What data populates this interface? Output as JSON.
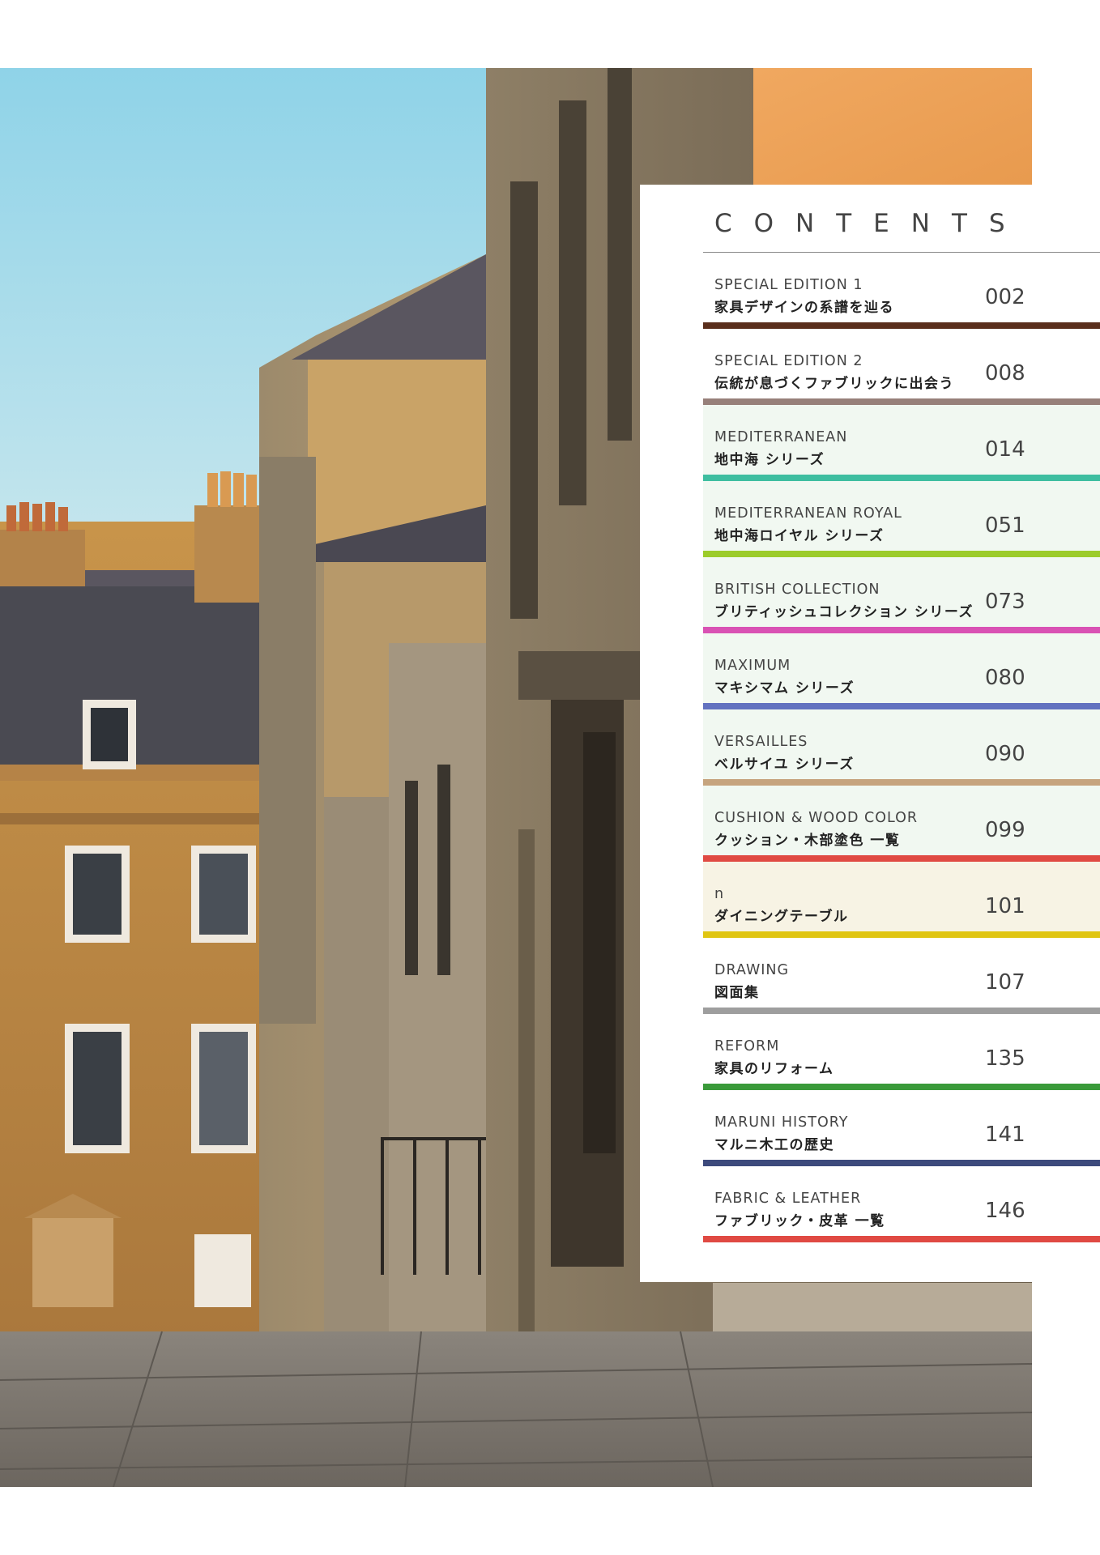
{
  "contents": {
    "title": "CONTENTS",
    "entries": [
      {
        "en": "SPECIAL EDITION 1",
        "jp": "家具デザインの系譜を辿る",
        "page": "002",
        "bar": "#5a2e1c",
        "bg": "#ffffff"
      },
      {
        "en": "SPECIAL EDITION 2",
        "jp": "伝統が息づくファブリックに出会う",
        "page": "008",
        "bar": "#97807a",
        "bg": "#ffffff"
      },
      {
        "en": "MEDITERRANEAN",
        "jp": "地中海 シリーズ",
        "page": "014",
        "bar": "#3ebea0",
        "bg": "#f1f8f1"
      },
      {
        "en": "MEDITERRANEAN ROYAL",
        "jp": "地中海ロイヤル シリーズ",
        "page": "051",
        "bar": "#9ccc2a",
        "bg": "#f1f8f1"
      },
      {
        "en": "BRITISH COLLECTION",
        "jp": "ブリティッシュコレクション シリーズ",
        "page": "073",
        "bar": "#d952b4",
        "bg": "#f1f8f1"
      },
      {
        "en": "MAXIMUM",
        "jp": "マキシマム シリーズ",
        "page": "080",
        "bar": "#6272c0",
        "bg": "#f1f8f1"
      },
      {
        "en": "VERSAILLES",
        "jp": "ベルサイユ シリーズ",
        "page": "090",
        "bar": "#c6a47e",
        "bg": "#f1f8f1"
      },
      {
        "en": "CUSHION & WOOD COLOR",
        "jp": "クッション・木部塗色 一覧",
        "page": "099",
        "bar": "#e04a43",
        "bg": "#f1f8f1"
      },
      {
        "en": "n",
        "jp": "ダイニングテーブル",
        "page": "101",
        "bar": "#e0c512",
        "bg": "#f7f3e4"
      },
      {
        "en": "DRAWING",
        "jp": "図面集",
        "page": "107",
        "bar": "#9e9e9e",
        "bg": "#ffffff"
      },
      {
        "en": "REFORM",
        "jp": "家具のリフォーム",
        "page": "135",
        "bar": "#3a9a3a",
        "bg": "#ffffff"
      },
      {
        "en": "MARUNI HISTORY",
        "jp": "マルニ木工の歴史",
        "page": "141",
        "bar": "#3d4a7c",
        "bg": "#ffffff"
      },
      {
        "en": "FABRIC & LEATHER",
        "jp": "ファブリック・皮革 一覧",
        "page": "146",
        "bar": "#e04a43",
        "bg": "#ffffff"
      }
    ]
  }
}
